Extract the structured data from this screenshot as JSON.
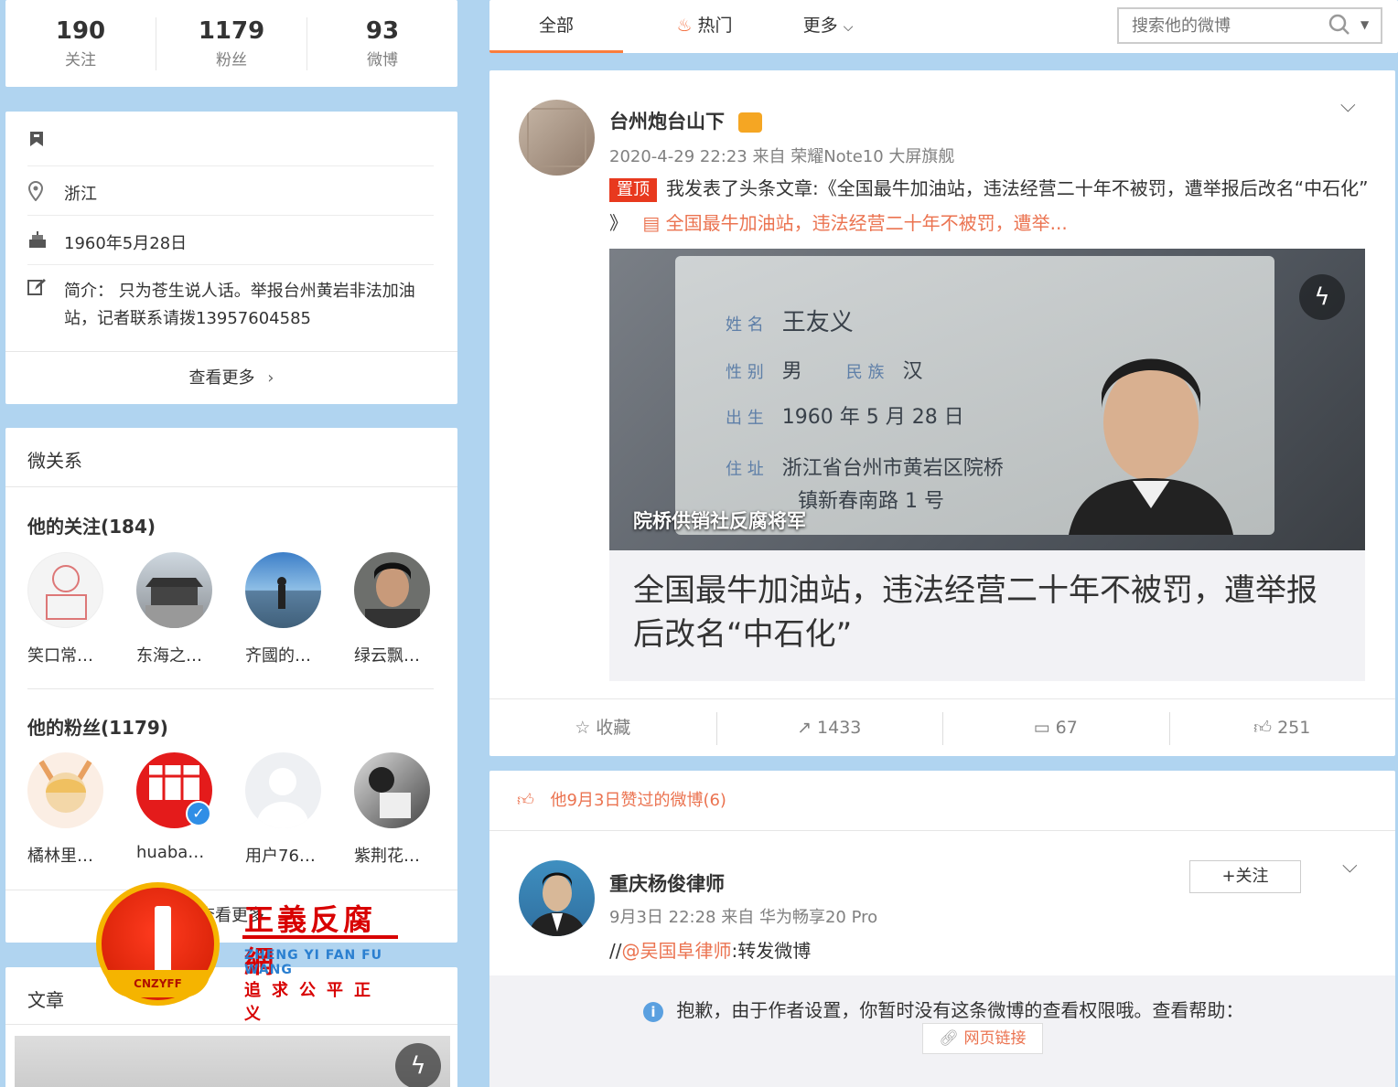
{
  "stats": [
    {
      "num": "190",
      "label": "关注"
    },
    {
      "num": "1179",
      "label": "粉丝"
    },
    {
      "num": "93",
      "label": "微博"
    }
  ],
  "profile": {
    "location": "浙江",
    "birthday": "1960年5月28日",
    "bio": "简介： 只为苍生说人话。举报台州黄岩非法加油站，记者联系请拨13957604585",
    "more": "查看更多"
  },
  "relations": {
    "title": "微关系",
    "following_head": "他的关注(184)",
    "following": [
      "笑口常…",
      "东海之…",
      "齐國的…",
      "绿云飘…"
    ],
    "fans_head": "他的粉丝(1179)",
    "fans": [
      "橘林里…",
      "huaba…",
      "用户76…",
      "紫荆花…"
    ],
    "more": "查看更多"
  },
  "articles": {
    "title": "文章"
  },
  "watermark": {
    "title": "正義反腐網",
    "pinyin": "ZHENG YI FAN FU WANG",
    "slogan": "追求公平正义",
    "badge": "CNZYFF"
  },
  "tabs": {
    "all": "全部",
    "hot": "热门",
    "more": "更多"
  },
  "search": {
    "placeholder": "搜索他的微博"
  },
  "post1": {
    "user": "台州炮台山下",
    "meta": "2020-4-29 22:23 来自 荣耀Note10 大屏旗舰",
    "pin": "置顶",
    "text": "我发表了头条文章:《全国最牛加油站，违法经营二十年不被罚，遭举报后改名“中石化” 》",
    "link": "全国最牛加油站，违法经营二十年不被罚，遭举...",
    "id_fields": {
      "name_k": "姓 名",
      "name_v": "王友义",
      "sex_k": "性 别",
      "sex_v": "男",
      "eth_k": "民 族",
      "eth_v": "汉",
      "birth_k": "出 生",
      "birth_v": "1960 年 5 月 28 日",
      "addr_k": "住 址",
      "addr_v1": "浙江省台州市黄岩区院桥",
      "addr_v2": "镇新春南路 1 号"
    },
    "caption": "院桥供销社反腐将军",
    "article_title": "全国最牛加油站，违法经营二十年不被罚，遭举报后改名“中石化”",
    "actions": {
      "fav": "收藏",
      "repost": "1433",
      "comment": "67",
      "like": "251"
    }
  },
  "post2": {
    "liked_label": "他9月3日赞过的微博(6)",
    "user": "重庆杨俊律师",
    "follow": "+关注",
    "meta": "9月3日 22:28 来自 华为畅享20 Pro",
    "text_prefix": "//",
    "mention": "@吴国阜律师",
    "text_suffix": ":转发微博",
    "notice": "抱歉，由于作者设置，你暂时没有这条微博的查看权限哦。查看帮助：",
    "web_link": "网页链接"
  }
}
